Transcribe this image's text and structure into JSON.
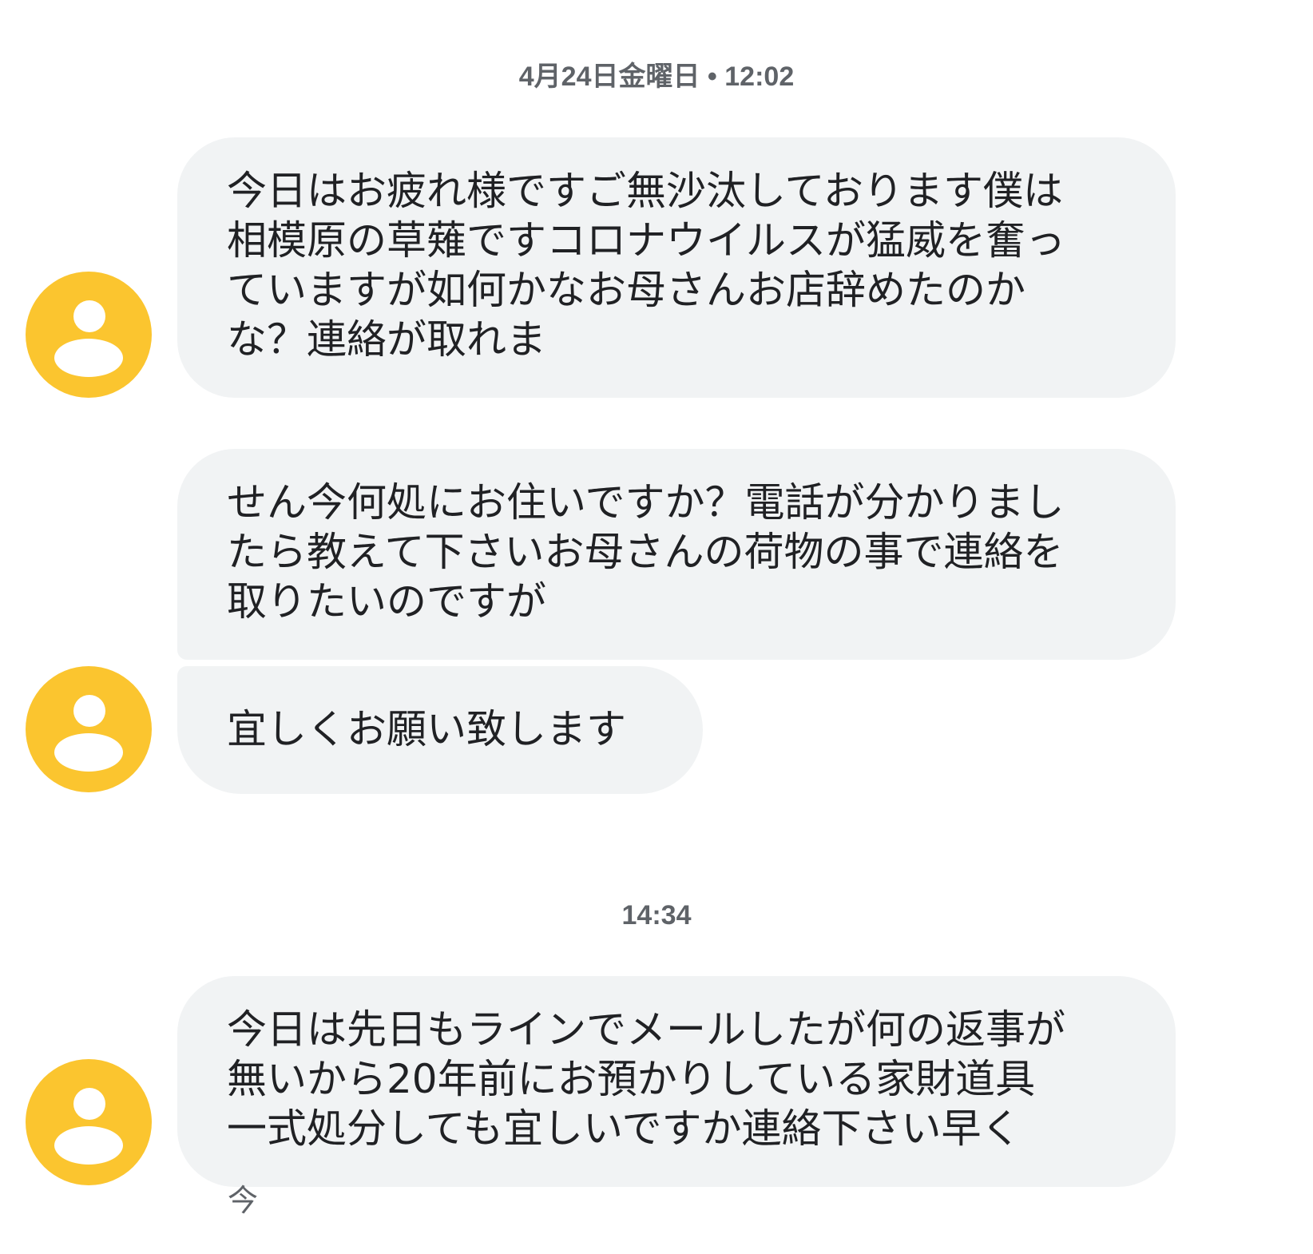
{
  "conversation": {
    "timestamp_1": "4月24日金曜日 • 12:02",
    "timestamp_2": "14:34",
    "messages": [
      {
        "lines": [
          "今日はお疲れ様ですご無沙汰しております僕は",
          "相模原の草薙ですコロナウイルスが猛威を奮っ",
          "ていますが如何かなお母さんお店辞めたのか",
          "な？連絡が取れま"
        ]
      },
      {
        "lines": [
          "せん今何処にお住いですか？電話が分かりまし",
          "たら教えて下さいお母さんの荷物の事で連絡を",
          "取りたいのですが"
        ]
      },
      {
        "lines": [
          "宜しくお願い致します"
        ]
      },
      {
        "lines": [
          "今日は先日もラインでメールしたが何の返事が",
          "無いから20年前にお預かりしている家財道具",
          "一式処分しても宜しいですか連絡下さい早く"
        ]
      }
    ],
    "last_status": "今"
  },
  "colors": {
    "avatar": "#fbc52f",
    "bubble": "#f1f3f4",
    "timestamp": "#5f6368"
  },
  "icons": [
    "person-avatar-icon"
  ]
}
